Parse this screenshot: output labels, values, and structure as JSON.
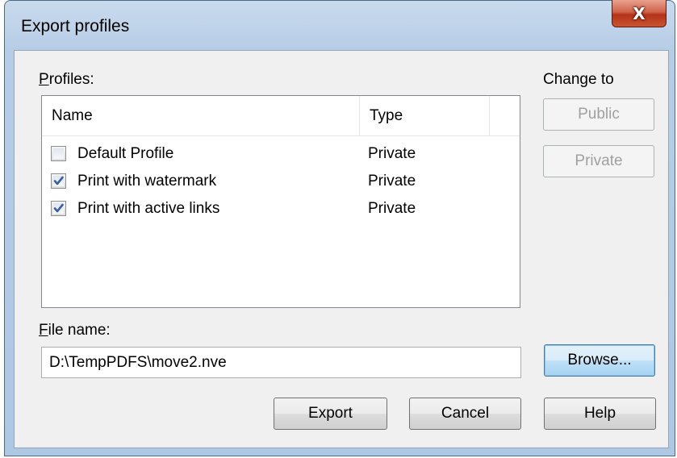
{
  "window": {
    "title": "Export profiles",
    "close_glyph": "X"
  },
  "profiles": {
    "label": "Profiles:",
    "columns": [
      "Name",
      "Type"
    ],
    "rows": [
      {
        "name": "Default Profile",
        "type": "Private",
        "checked": false
      },
      {
        "name": "Print with watermark",
        "type": "Private",
        "checked": true
      },
      {
        "name": "Print with active links",
        "type": "Private",
        "checked": true
      }
    ]
  },
  "change_to": {
    "label": "Change to",
    "public_label": "Public",
    "private_label": "Private"
  },
  "file": {
    "label": "File name:",
    "value": "D:\\TempPDFS\\move2.nve",
    "browse_label": "Browse..."
  },
  "actions": {
    "export_label": "Export",
    "cancel_label": "Cancel",
    "help_label": "Help"
  },
  "colors": {
    "accent": "#3c7fb1",
    "close_button": "#c8552f",
    "frame": "#b7cde6"
  }
}
